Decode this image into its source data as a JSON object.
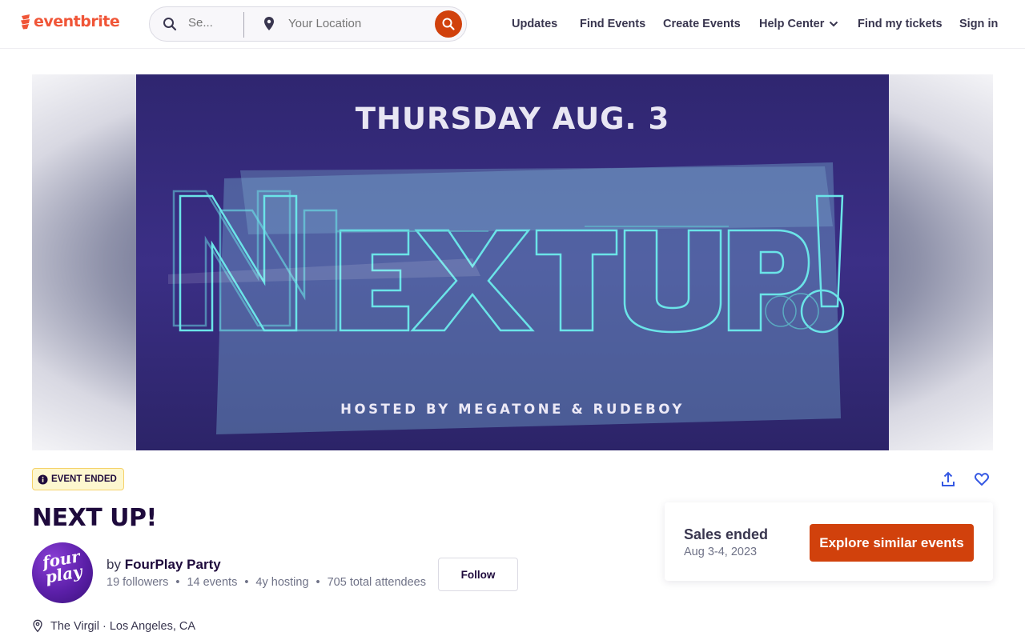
{
  "brand": {
    "name": "eventbrite",
    "accent": "#d1410c",
    "logo_color": "#f05537"
  },
  "search": {
    "placeholder": "Se...",
    "location_placeholder": "Your Location"
  },
  "nav": {
    "updates": "Updates",
    "find_events": "Find Events",
    "create_events": "Create Events",
    "help_center": "Help Center",
    "find_tickets": "Find my tickets",
    "sign_in": "Sign in"
  },
  "hero": {
    "date": "THURSDAY AUG. 3",
    "logo_text": "NEXT UP!",
    "hosted_by": "HOSTED BY MEGATONE & RUDEBOY"
  },
  "event": {
    "status": "EVENT ENDED",
    "title": "NEXT UP!",
    "organizer_prefix": "by",
    "organizer": "FourPlay Party",
    "avatar_text": "four play",
    "stats": {
      "followers": "19 followers",
      "events": "14 events",
      "hosting": "4y hosting",
      "attendees": "705 total attendees"
    },
    "follow_label": "Follow",
    "venue": "The Virgil",
    "city": "Los Angeles, CA"
  },
  "sales": {
    "title": "Sales ended",
    "date": "Aug 3-4, 2023",
    "cta": "Explore similar events"
  },
  "icons": [
    "eventbrite-logo-icon",
    "search-icon",
    "location-pin-icon",
    "chevron-down-icon",
    "info-icon",
    "share-icon",
    "heart-icon"
  ]
}
